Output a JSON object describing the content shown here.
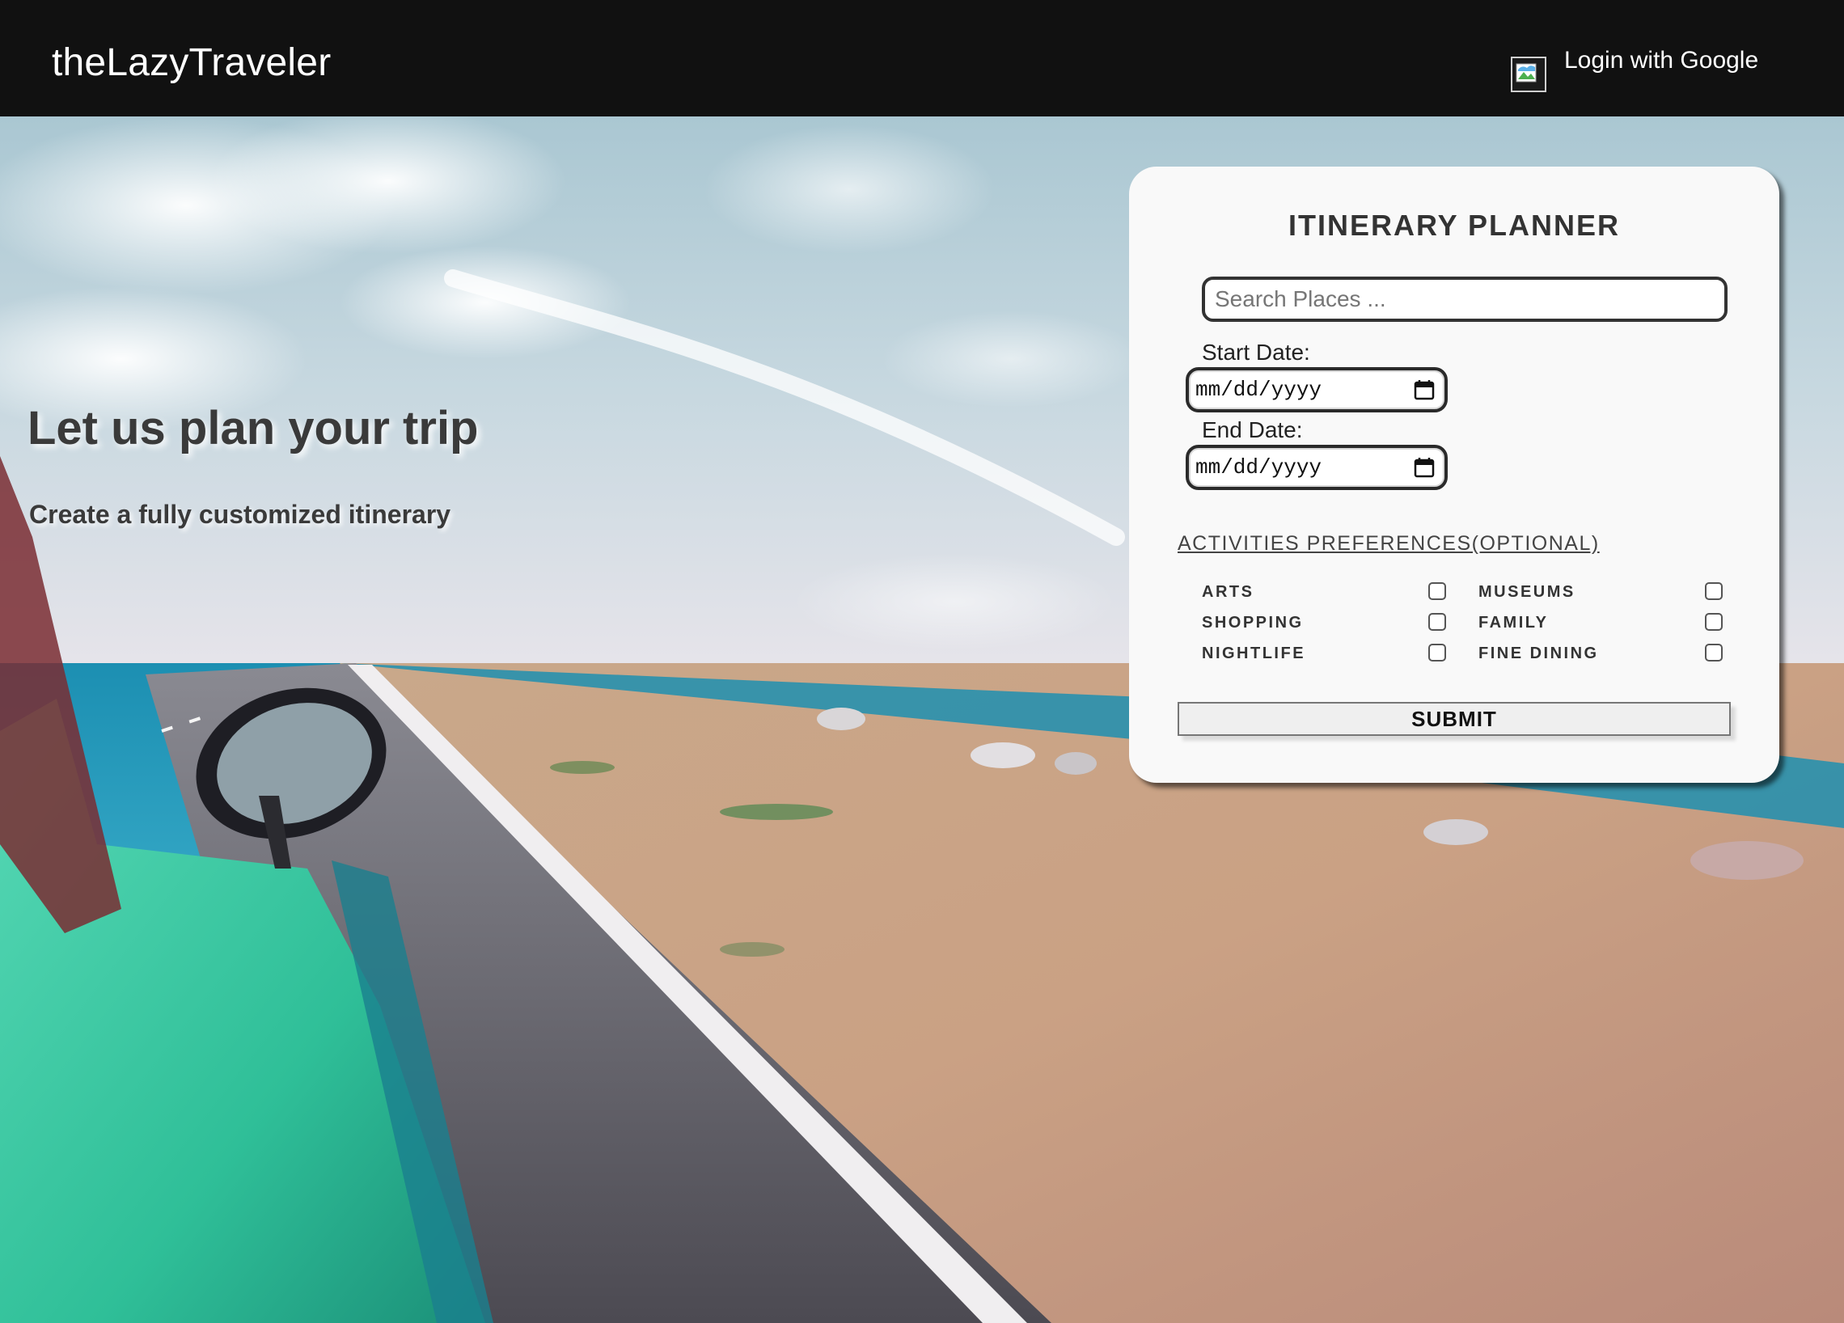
{
  "nav": {
    "brand": "theLazyTraveler",
    "login_label": "Login with Google"
  },
  "hero": {
    "title": "Let us plan your trip",
    "subtitle": "Create a fully customized itinerary"
  },
  "planner": {
    "title": "ITINERARY PLANNER",
    "search_placeholder": "Search Places ...",
    "search_value": "",
    "start_label": "Start Date:",
    "start_value": "mm/dd/yyyy",
    "end_label": "End Date:",
    "end_value": "mm/dd/yyyy",
    "preferences_heading": "ACTIVITIES PREFERENCES(OPTIONAL)",
    "preferences": [
      {
        "label": "ARTS",
        "checked": false
      },
      {
        "label": "MUSEUMS",
        "checked": false
      },
      {
        "label": "SHOPPING",
        "checked": false
      },
      {
        "label": "FAMILY",
        "checked": false
      },
      {
        "label": "NIGHTLIFE",
        "checked": false
      },
      {
        "label": "FINE DINING",
        "checked": false
      }
    ],
    "submit_label": "SUBMIT"
  },
  "icons": {
    "login": "broken-image-icon",
    "date": "calendar-icon"
  },
  "colors": {
    "navbar": "#111111",
    "card": "#f9f9f9",
    "car": "#3cc8a0",
    "sea": "#1f8fb0"
  }
}
